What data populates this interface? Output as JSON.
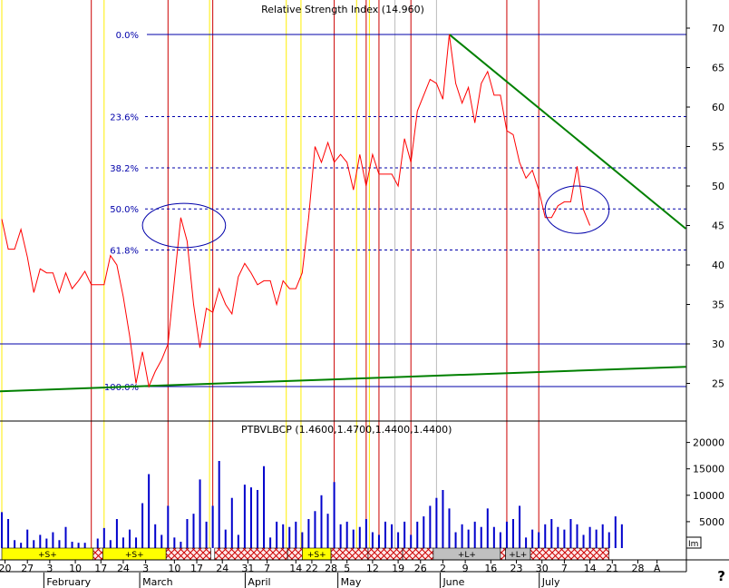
{
  "colors": {
    "price": "#ff0000",
    "trend": "#008000",
    "fib": "#0000aa",
    "volume": "#0000cc",
    "vline_red": "#cc0000",
    "vline_yellow": "#ffee00",
    "vline_gray": "#bbbbbb",
    "signal_buy": "#ffff00",
    "signal_long": "#c0c0c0",
    "signal_hatch": "#cc0000"
  },
  "chart_data": [
    {
      "type": "line",
      "title": "Relative Strength Index (14.960)",
      "ylim": [
        20,
        72
      ],
      "yticks": [
        25,
        30,
        35,
        40,
        45,
        50,
        55,
        60,
        65,
        70
      ],
      "x_days": 107,
      "price_x": [
        0,
        1,
        2,
        3,
        4,
        5,
        6,
        7,
        8,
        9,
        10,
        11,
        12,
        13,
        14,
        15,
        16,
        17,
        18,
        19,
        20,
        21,
        22,
        23,
        24,
        25,
        26,
        27,
        28,
        29,
        30,
        31,
        32,
        33,
        34,
        35,
        36,
        37,
        38,
        39,
        40,
        41,
        42,
        43,
        44,
        45,
        46,
        47,
        48,
        49,
        50,
        51,
        52,
        53,
        54,
        55,
        56,
        57,
        58,
        59,
        60,
        61,
        62,
        63,
        64,
        65,
        66,
        67,
        68,
        69,
        70,
        71,
        72,
        73,
        74,
        75,
        76,
        77,
        78,
        79,
        80,
        81,
        82,
        83,
        84,
        85,
        86,
        87,
        88,
        89,
        90,
        91,
        92,
        93,
        94,
        95,
        96,
        97,
        98
      ],
      "price": [
        45.8,
        42,
        42,
        44.5,
        41,
        36.5,
        39.5,
        39,
        39,
        36.5,
        39,
        37,
        38,
        39.2,
        37.5,
        37.5,
        37.5,
        41.2,
        40,
        36,
        31,
        25,
        29,
        24.6,
        26.5,
        28,
        30,
        38,
        46,
        43,
        35,
        29.5,
        34.5,
        34,
        37,
        35,
        33.8,
        38.5,
        40.2,
        39,
        37.5,
        38,
        38,
        35,
        38,
        37,
        37,
        39,
        46,
        55,
        53,
        55.5,
        53,
        54,
        53,
        49.5,
        54,
        50,
        54,
        51.5,
        51.5,
        51.5,
        50,
        56,
        53,
        59.5,
        61.5,
        63.5,
        63,
        61,
        69.2,
        63,
        60.5,
        62.5,
        58,
        63,
        64.5,
        61.5,
        61.5,
        57,
        56.5,
        53,
        51,
        52,
        49.5,
        46,
        46,
        47.5,
        48,
        48,
        52.5,
        47,
        45
      ],
      "fib_levels": [
        {
          "label": "0.0%",
          "value": 69.2
        },
        {
          "label": "23.6%",
          "value": 58.8
        },
        {
          "label": "38.2%",
          "value": 52.3
        },
        {
          "label": "50.0%",
          "value": 47.1
        },
        {
          "label": "61.8%",
          "value": 41.9
        },
        {
          "label": "100.0%",
          "value": 24.6
        }
      ],
      "hlines": [
        30
      ],
      "trendlines": [
        {
          "x": [
            70,
            107
          ],
          "y": [
            69.2,
            44.6
          ]
        },
        {
          "x": [
            -0.3,
            107
          ],
          "y": [
            24,
            27.1
          ]
        }
      ],
      "ellipses": [
        {
          "cx": 28.5,
          "cy": 45,
          "rx": 6.5,
          "ry": 2.8
        },
        {
          "cx": 90,
          "cy": 47,
          "rx": 5,
          "ry": 3
        }
      ]
    },
    {
      "type": "bar",
      "title": "PTBVLBCP (1.4600,1.4700,1.4400,1.4400)",
      "ylim": [
        0,
        25000
      ],
      "yticks": [
        5000,
        10000,
        15000,
        20000
      ],
      "x": [
        0,
        1,
        2,
        3,
        4,
        5,
        6,
        7,
        8,
        9,
        10,
        11,
        12,
        13,
        15,
        16,
        17,
        18,
        19,
        20,
        21,
        22,
        23,
        24,
        25,
        26,
        27,
        28,
        29,
        30,
        31,
        32,
        33,
        34,
        35,
        36,
        37,
        38,
        39,
        40,
        41,
        42,
        43,
        44,
        45,
        46,
        47,
        48,
        49,
        50,
        51,
        52,
        53,
        54,
        55,
        56,
        57,
        58,
        59,
        60,
        61,
        62,
        63,
        64,
        65,
        66,
        67,
        68,
        69,
        70,
        71,
        72,
        73,
        74,
        75,
        76,
        77,
        78,
        79,
        80,
        81,
        82,
        83,
        84,
        85,
        86,
        87,
        88,
        89,
        90,
        91,
        92,
        93,
        94,
        95,
        96,
        97
      ],
      "values": [
        6800,
        5500,
        1500,
        1000,
        3500,
        1500,
        2500,
        1800,
        3000,
        1500,
        4000,
        1200,
        1000,
        1000,
        1800,
        3800,
        1500,
        5500,
        2000,
        3500,
        2000,
        8500,
        14000,
        4500,
        2500,
        8000,
        2000,
        1200,
        5500,
        6500,
        13000,
        5000,
        8000,
        16500,
        3500,
        9500,
        2500,
        12000,
        11500,
        11000,
        15500,
        2000,
        5000,
        4500,
        4000,
        5000,
        3000,
        5500,
        7000,
        10000,
        6500,
        12500,
        4500,
        5000,
        3500,
        4000,
        5500,
        3000,
        2500,
        5000,
        4500,
        3000,
        5000,
        2500,
        5000,
        6000,
        8000,
        9500,
        11000,
        7500,
        3000,
        4500,
        3500,
        5000,
        4000,
        7500,
        4000,
        3000,
        5000,
        5500,
        8000,
        2000,
        3500,
        3000,
        4500,
        5500,
        4000,
        3500,
        5500,
        4500,
        2500,
        4000,
        3500,
        4500,
        3000,
        6000,
        4500
      ]
    }
  ],
  "ylabels": {
    "top": [
      "70",
      "65",
      "60",
      "55",
      "50",
      "45",
      "40",
      "35",
      "30",
      "25"
    ],
    "bottom": [
      "20000",
      "15000",
      "10000",
      "5000"
    ],
    "scale_tag": "Im"
  },
  "vlines": {
    "red": [
      14,
      26,
      33,
      52,
      57,
      59,
      64,
      79,
      84
    ],
    "yellow": [
      0,
      16,
      32.5,
      44.5,
      46.8,
      55.5,
      57.5
    ],
    "gray": [
      61.5,
      68
    ]
  },
  "signals": [
    {
      "label": "+S+",
      "kind": "buy",
      "x0": 0,
      "x1": 14.3
    },
    {
      "kind": "hatch",
      "x0": 14.3,
      "x1": 15.8
    },
    {
      "label": "+S+",
      "kind": "buy",
      "x0": 15.8,
      "x1": 25.7
    },
    {
      "kind": "hatch",
      "x0": 25.7,
      "x1": 32.7
    },
    {
      "kind": "hatch",
      "x0": 33.3,
      "x1": 44.7
    },
    {
      "kind": "hatch",
      "x0": 44.7,
      "x1": 47
    },
    {
      "label": "+S+",
      "kind": "buy",
      "x0": 47,
      "x1": 51.5
    },
    {
      "kind": "hatch",
      "x0": 51.5,
      "x1": 57.3
    },
    {
      "kind": "hatch",
      "x0": 57.3,
      "x1": 62.7
    },
    {
      "kind": "hatch",
      "x0": 62.7,
      "x1": 67.5
    },
    {
      "label": "+L+",
      "kind": "long",
      "x0": 67.5,
      "x1": 78
    },
    {
      "kind": "hatch",
      "x0": 78,
      "x1": 78.8
    },
    {
      "label": "+L+",
      "kind": "long",
      "x0": 78.8,
      "x1": 82.7
    },
    {
      "kind": "hatch",
      "x0": 82.7,
      "x1": 95
    }
  ],
  "xaxis": {
    "days": [
      {
        "label": "20",
        "x": 0.5
      },
      {
        "label": "27",
        "x": 4
      },
      {
        "label": "3",
        "x": 7.5
      },
      {
        "label": "10",
        "x": 11.5
      },
      {
        "label": "17",
        "x": 15.5
      },
      {
        "label": "24",
        "x": 19
      },
      {
        "label": "3",
        "x": 22.5
      },
      {
        "label": "10",
        "x": 27
      },
      {
        "label": "17",
        "x": 30.5
      },
      {
        "label": "24",
        "x": 34.5
      },
      {
        "label": "31",
        "x": 38.5
      },
      {
        "label": "7",
        "x": 41.5
      },
      {
        "label": "14",
        "x": 46
      },
      {
        "label": "22",
        "x": 48.5
      },
      {
        "label": "28",
        "x": 51.5
      },
      {
        "label": "5",
        "x": 54
      },
      {
        "label": "12",
        "x": 58
      },
      {
        "label": "19",
        "x": 62
      },
      {
        "label": "26",
        "x": 65.5
      },
      {
        "label": "2",
        "x": 69
      },
      {
        "label": "9",
        "x": 72.5
      },
      {
        "label": "16",
        "x": 76.5
      },
      {
        "label": "23",
        "x": 80.5
      },
      {
        "label": "30",
        "x": 84.5
      },
      {
        "label": "7",
        "x": 88
      },
      {
        "label": "14",
        "x": 92
      },
      {
        "label": "21",
        "x": 95.5
      },
      {
        "label": "28",
        "x": 99.5
      },
      {
        "label": "A",
        "x": 102.5
      }
    ],
    "months": [
      {
        "label": "February",
        "x": 7
      },
      {
        "label": "March",
        "x": 22
      },
      {
        "label": "April",
        "x": 38.5
      },
      {
        "label": "May",
        "x": 53
      },
      {
        "label": "June",
        "x": 69
      },
      {
        "label": "July",
        "x": 84.5
      }
    ]
  },
  "help_glyph": "?"
}
